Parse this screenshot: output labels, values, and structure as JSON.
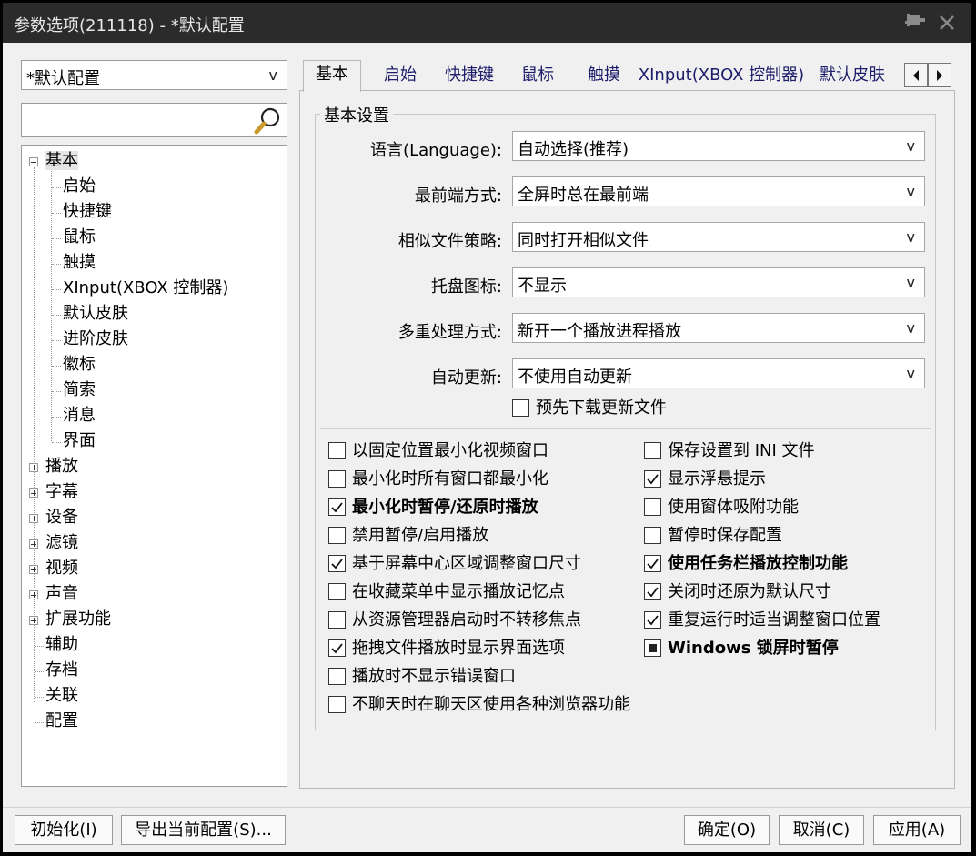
{
  "window": {
    "title": "参数选项(211118) - *默认配置"
  },
  "sidebar": {
    "profile": "*默认配置",
    "search": {
      "value": "",
      "placeholder": ""
    },
    "tree": [
      {
        "label": "基本",
        "expanded": true,
        "selected": true
      },
      {
        "label": "启始",
        "child": true
      },
      {
        "label": "快捷键",
        "child": true
      },
      {
        "label": "鼠标",
        "child": true
      },
      {
        "label": "触摸",
        "child": true
      },
      {
        "label": "XInput(XBOX 控制器)",
        "child": true
      },
      {
        "label": "默认皮肤",
        "child": true
      },
      {
        "label": "进阶皮肤",
        "child": true
      },
      {
        "label": "徽标",
        "child": true
      },
      {
        "label": "简索",
        "child": true
      },
      {
        "label": "消息",
        "child": true
      },
      {
        "label": "界面",
        "child": true
      },
      {
        "label": "播放",
        "expandable": true
      },
      {
        "label": "字幕",
        "expandable": true
      },
      {
        "label": "设备",
        "expandable": true
      },
      {
        "label": "滤镜",
        "expandable": true
      },
      {
        "label": "视频",
        "expandable": true
      },
      {
        "label": "声音",
        "expandable": true
      },
      {
        "label": "扩展功能",
        "expandable": true
      },
      {
        "label": "辅助"
      },
      {
        "label": "存档"
      },
      {
        "label": "关联"
      },
      {
        "label": "配置"
      }
    ]
  },
  "tabs": [
    {
      "label": "基本",
      "active": true
    },
    {
      "label": "启始"
    },
    {
      "label": "快捷键"
    },
    {
      "label": "鼠标"
    },
    {
      "label": "触摸"
    },
    {
      "label": "XInput(XBOX 控制器)"
    },
    {
      "label": "默认皮肤"
    }
  ],
  "basic": {
    "group_title": "基本设置",
    "settings": [
      {
        "label": "语言(Language):",
        "value": "自动选择(推荐)"
      },
      {
        "label": "最前端方式:",
        "value": "全屏时总在最前端"
      },
      {
        "label": "相似文件策略:",
        "value": "同时打开相似文件"
      },
      {
        "label": "托盘图标:",
        "value": "不显示"
      },
      {
        "label": "多重处理方式:",
        "value": "新开一个播放进程播放"
      },
      {
        "label": "自动更新:",
        "value": "不使用自动更新"
      }
    ],
    "predownload": {
      "label": "预先下载更新文件",
      "checked": false
    },
    "left_checks": [
      {
        "label": "以固定位置最小化视频窗口",
        "state": "unchecked"
      },
      {
        "label": "最小化时所有窗口都最小化",
        "state": "unchecked"
      },
      {
        "label": "最小化时暂停/还原时播放",
        "state": "checked",
        "bold": true
      },
      {
        "label": "禁用暂停/启用播放",
        "state": "unchecked"
      },
      {
        "label": "基于屏幕中心区域调整窗口尺寸",
        "state": "checked"
      },
      {
        "label": "在收藏菜单中显示播放记忆点",
        "state": "unchecked"
      },
      {
        "label": "从资源管理器启动时不转移焦点",
        "state": "unchecked"
      },
      {
        "label": "拖拽文件播放时显示界面选项",
        "state": "checked"
      },
      {
        "label": "播放时不显示错误窗口",
        "state": "unchecked"
      },
      {
        "label": "不聊天时在聊天区使用各种浏览器功能",
        "state": "unchecked"
      }
    ],
    "right_checks": [
      {
        "label": "保存设置到 INI 文件",
        "state": "unchecked"
      },
      {
        "label": "显示浮悬提示",
        "state": "checked"
      },
      {
        "label": "使用窗体吸附功能",
        "state": "unchecked"
      },
      {
        "label": "暂停时保存配置",
        "state": "unchecked"
      },
      {
        "label": "使用任务栏播放控制功能",
        "state": "checked",
        "bold": true
      },
      {
        "label": "关闭时还原为默认尺寸",
        "state": "checked"
      },
      {
        "label": "重复运行时适当调整窗口位置",
        "state": "checked"
      },
      {
        "label": "Windows 锁屏时暂停",
        "state": "indeterminate",
        "bold": true
      }
    ]
  },
  "buttons": {
    "init": "初始化(I)",
    "export": "导出当前配置(S)...",
    "ok": "确定(O)",
    "cancel": "取消(C)",
    "apply": "应用(A)"
  }
}
